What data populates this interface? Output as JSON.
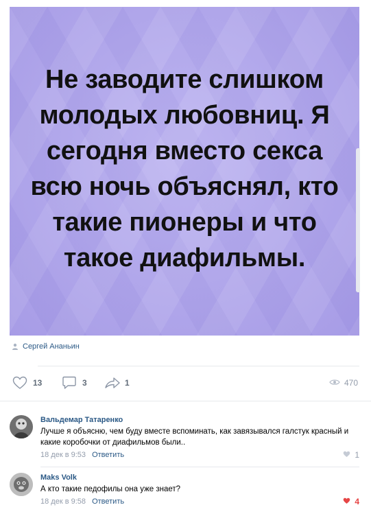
{
  "post": {
    "quote": "Не заводите слишком молодых любовниц. Я сегодня вместо секса всю ночь объяснял, кто такие пионеры и что такое диафильмы.",
    "author": "Сергей Ананьин",
    "likes": "13",
    "comments": "3",
    "shares": "1",
    "views": "470"
  },
  "comments": [
    {
      "name": "Вальдемар Татаренко",
      "text": "Лучше я объясню, чем буду вместе вспоминать, как завязывался галстук красный и какие коробочки от диафильмов были..",
      "time": "18 дек в 9:53",
      "reply": "Ответить",
      "likes": "1"
    },
    {
      "name": "Maks Volk",
      "text": "А кто такие педофилы она уже знает?",
      "time": "18 дек в 9:58",
      "reply": "Ответить",
      "likes": "4"
    }
  ],
  "colors": {
    "link": "#2a5885",
    "muted": "#939cab",
    "like_active": "#e64646",
    "image_bg": "#b3a9ee"
  }
}
